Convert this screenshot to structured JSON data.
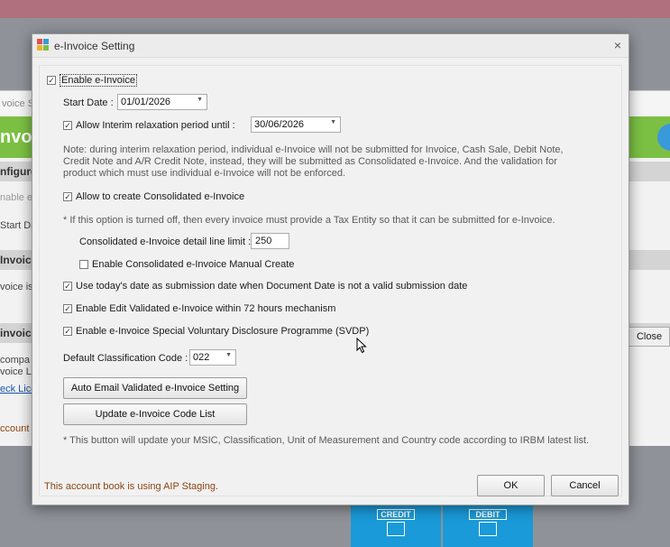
{
  "background": {
    "title": "voice S",
    "header": "nvoi",
    "band1": "nfigure",
    "line1": "nable e",
    "line2": "Start Da",
    "band2": "Invoice",
    "line3": "voice is",
    "band3": "invoice",
    "line4": "compa",
    "line5": "voice Li",
    "link": "eck Licen",
    "line6": "ccount b",
    "close_label": "Close",
    "tile_credit": "CREDIT",
    "tile_debit": "DEBIT"
  },
  "dialog": {
    "title": "e-Invoice Setting",
    "close_glyph": "×",
    "enable_einvoice": {
      "label": "Enable e-Invoice",
      "checked": true
    },
    "start_date": {
      "label": "Start Date :",
      "value": "01/01/2026"
    },
    "interim": {
      "label": "Allow Interim relaxation period until :",
      "checked": true,
      "value": "30/06/2026"
    },
    "interim_note": [
      "Note: during interim relaxation period, individual e-Invoice will not be submitted for Invoice, Cash Sale, Debit Note,",
      "Credit Note and A/R Credit Note, instead, they will be submitted as Consolidated e-Invoice. And the validation for",
      "product which must use individual e-Invoice will not be enforced."
    ],
    "consolidated": {
      "label": "Allow to create Consolidated e-Invoice",
      "checked": true
    },
    "consolidated_note": "* If this option is turned off, then every invoice must provide a Tax Entity so that it can be submitted for e-Invoice.",
    "line_limit": {
      "label": "Consolidated e-Invoice detail line limit :",
      "value": "250"
    },
    "manual_create": {
      "label": "Enable Consolidated e-Invoice Manual Create",
      "checked": false
    },
    "today_date": {
      "label": "Use today's date as submission date when Document Date is not a valid submission date",
      "checked": true
    },
    "edit_validated": {
      "label": "Enable Edit Validated e-Invoice within 72 hours mechanism",
      "checked": true
    },
    "svdp": {
      "label": "Enable e-Invoice Special Voluntary Disclosure Programme (SVDP)",
      "checked": true
    },
    "classification": {
      "label": "Default Classification Code :",
      "value": "022"
    },
    "auto_email_button": "Auto Email Validated e-Invoice Setting",
    "update_code_button": "Update e-Invoice Code List",
    "update_note": "* This button will update your MSIC, Classification, Unit of Measurement and Country code according to IRBM latest list.",
    "staging_text": "This account book is using AIP Staging.",
    "ok_button": "OK",
    "cancel_button": "Cancel",
    "check_glyph": "✓",
    "arrow_glyph": "▼"
  }
}
